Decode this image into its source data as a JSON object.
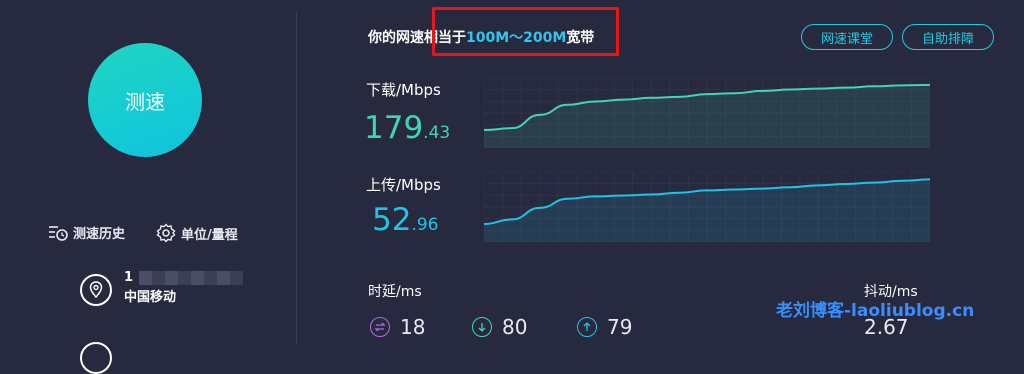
{
  "left": {
    "speed_button": "测速",
    "history_link": "测速历史",
    "unit_link": "单位/量程",
    "ip_prefix": "1",
    "isp_name": "中国移动",
    "colors": {
      "speed_button_gradient": [
        "#1fd6c2",
        "#0fc3de"
      ]
    }
  },
  "header": {
    "result_prefix": "你的网速相当于",
    "result_range": "100M～200M",
    "result_suffix": "宽带",
    "classroom_button": "网速课堂",
    "troubleshoot_button": "自助排障"
  },
  "download": {
    "label": "下载/Mbps",
    "value_int": "179",
    "value_dec": ".43",
    "color": "#3fd6b0",
    "curve": [
      0,
      0.04,
      0.33,
      0.55,
      0.62,
      0.66,
      0.7,
      0.72,
      0.78,
      0.8,
      0.85,
      0.88,
      0.9,
      0.92,
      0.95,
      0.97,
      0.98
    ]
  },
  "upload": {
    "label": "上传/Mbps",
    "value_int": "52",
    "value_dec": ".96",
    "color": "#1ec3e6",
    "curve": [
      0,
      0.1,
      0.35,
      0.55,
      0.6,
      0.62,
      0.64,
      0.68,
      0.73,
      0.75,
      0.77,
      0.8,
      0.84,
      0.87,
      0.9,
      0.94,
      0.97
    ]
  },
  "latency": {
    "label": "时延/ms",
    "idle": "18",
    "down": "80",
    "up": "79",
    "colors": {
      "idle": "#b066e8",
      "down": "#3fd6b0",
      "up": "#1ec3e6"
    }
  },
  "jitter": {
    "label": "抖动/ms",
    "value": "2.67"
  },
  "watermark": "老刘博客-laoliublog.cn"
}
